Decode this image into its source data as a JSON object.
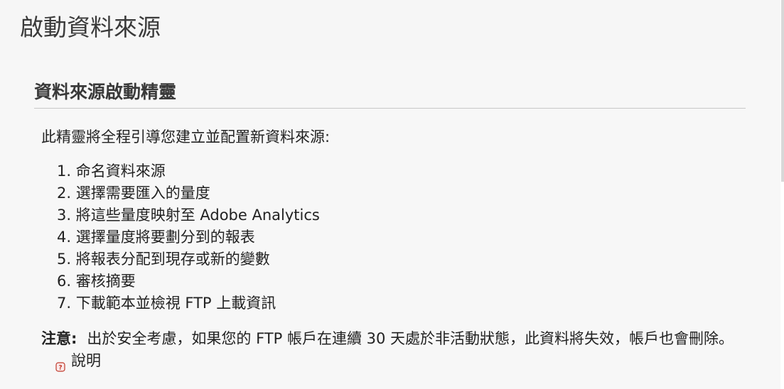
{
  "page": {
    "title": "啟動資料來源"
  },
  "wizard": {
    "heading": "資料來源啟動精靈",
    "intro": "此精靈將全程引導您建立並配置新資料來源:",
    "steps": [
      "1. 命名資料來源",
      "2. 選擇需要匯入的量度",
      "3. 將這些量度映射至 Adobe Analytics",
      "4. 選擇量度將要劃分到的報表",
      "5. 將報表分配到現存或新的變數",
      "6. 審核摘要",
      "7. 下載範本並檢視 FTP 上載資訊"
    ],
    "note_label": "注意:",
    "note_text": "出於安全考慮，如果您的 FTP 帳戶在連續 30 天處於非活動狀態，此資料將失效，帳戶也會刪除。",
    "help_label": "說明",
    "help_icon": "help-icon"
  },
  "colors": {
    "title": "#3a3a3a",
    "text": "#222222",
    "rule": "#c8c8c8",
    "help_icon": "#c0392b"
  }
}
